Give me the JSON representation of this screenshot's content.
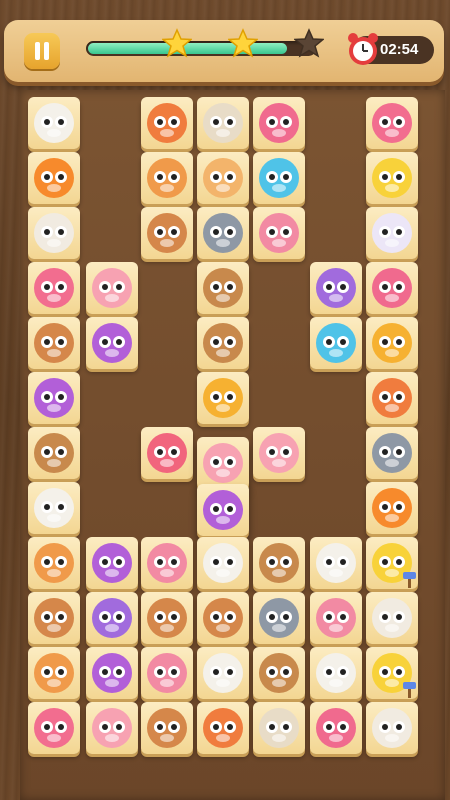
{
  "header": {
    "timer": "02:54",
    "progress_fraction": 0.88,
    "stars_earned": 2,
    "stars_total": 3
  },
  "colors": {
    "sheep": "#f4f1ea",
    "squirrel": "#f07c3e",
    "bulldog": "#e8dcc7",
    "crab": "#f06a8e",
    "hippo": "#f26d8f",
    "fish": "#f78a2c",
    "monkey": "#f09a4a",
    "cat": "#f3b46b",
    "pufferfish": "#4fc3e8",
    "chick": "#f8d23a",
    "cow": "#f1ebe1",
    "bear": "#d5874a",
    "raccoon": "#8e98a5",
    "mouse": "#ece6f7",
    "pig": "#f7a2b2",
    "owl": "#a16bdd",
    "tiger": "#f6b131",
    "purple_hippo": "#b25fd8",
    "octopus": "#f1657d",
    "bird_pink": "#f28aa3",
    "hammer": "#5d87e6"
  },
  "board": {
    "tiles": [
      {
        "animal": "sheep"
      },
      {
        "animal": "squirrel"
      },
      {
        "animal": "bulldog"
      },
      {
        "animal": "crab"
      },
      {
        "animal": "hippo"
      },
      {
        "animal": "fish"
      },
      {
        "animal": "monkey"
      },
      {
        "animal": "cat"
      },
      {
        "animal": "pufferfish"
      },
      {
        "animal": "chick"
      },
      {
        "animal": "cow"
      },
      {
        "animal": "bear"
      },
      {
        "animal": "raccoon"
      },
      {
        "animal": "bird_pink"
      },
      {
        "animal": "mouse"
      },
      {
        "animal": "hippo"
      },
      {
        "animal": "pig"
      },
      {
        "animal": "squirrel_brown"
      },
      {
        "animal": "owl"
      },
      {
        "animal": "crab"
      },
      {
        "animal": "bear"
      },
      {
        "animal": "purple_hippo"
      },
      {
        "animal": "squirrel_brown"
      },
      {
        "animal": "pufferfish"
      },
      {
        "animal": "tiger"
      },
      {
        "animal": "purple_hippo"
      },
      {
        "animal": "tiger"
      },
      {
        "animal": "squirrel"
      },
      {
        "animal": "squirrel_brown"
      },
      {
        "animal": "octopus"
      },
      {
        "animal": "pig"
      },
      {
        "animal": "pig"
      },
      {
        "animal": "raccoon"
      },
      {
        "animal": "sheep"
      },
      {
        "animal": "purple_hippo"
      },
      {
        "animal": "fish"
      },
      {
        "animal": "monkey"
      },
      {
        "animal": "purple_hippo"
      },
      {
        "animal": "bird_pink"
      },
      {
        "animal": "sheep"
      },
      {
        "animal": "squirrel_brown"
      },
      {
        "animal": "sheep"
      },
      {
        "animal": "chick_hammer"
      },
      {
        "animal": "bear"
      },
      {
        "animal": "owl"
      },
      {
        "animal": "bear"
      },
      {
        "animal": "bear"
      },
      {
        "animal": "raccoon"
      },
      {
        "animal": "bird_pink"
      },
      {
        "animal": "cow"
      },
      {
        "animal": "monkey"
      },
      {
        "animal": "purple_hippo"
      },
      {
        "animal": "bird_pink"
      },
      {
        "animal": "sheep"
      },
      {
        "animal": "squirrel_brown"
      },
      {
        "animal": "sheep"
      },
      {
        "animal": "chick_hammer"
      },
      {
        "animal": "hippo"
      },
      {
        "animal": "pig"
      },
      {
        "animal": "bear"
      },
      {
        "animal": "squirrel"
      },
      {
        "animal": "bulldog"
      },
      {
        "animal": "crab"
      },
      {
        "animal": "cow"
      }
    ]
  }
}
